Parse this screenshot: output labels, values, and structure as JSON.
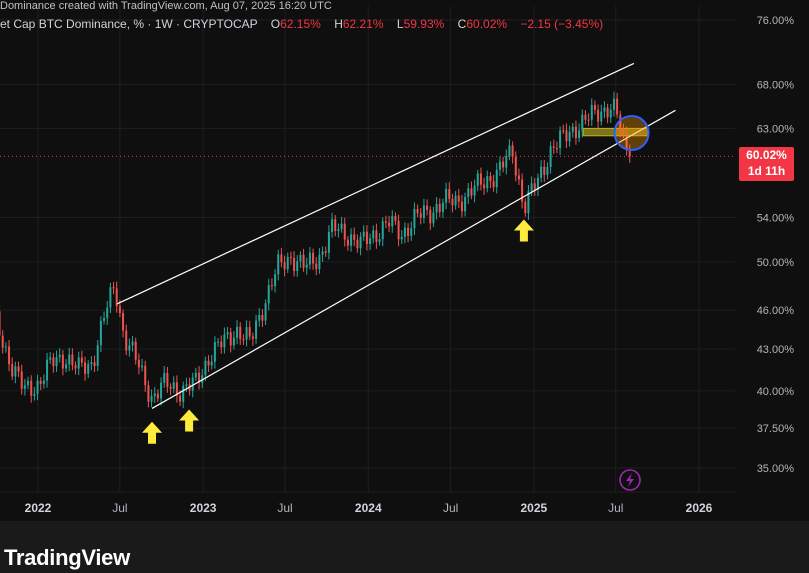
{
  "header": {
    "cropped_caption": "Dominance created with TradingView.com, Aug 07, 2025 16:20 UTC",
    "title": "et Cap BTC Dominance, % · 1W · CRYPTOCAP",
    "o_label": "O",
    "o_value": "62.15%",
    "h_label": "H",
    "h_value": "62.21%",
    "l_label": "L",
    "l_value": "59.93%",
    "c_label": "C",
    "c_value": "60.02%",
    "change": "−2.15 (−3.45%)"
  },
  "price_badge": {
    "price": "60.02%",
    "countdown": "1d 11h"
  },
  "footer": {
    "brand": "TradingView"
  },
  "colors": {
    "up": "#26a69a",
    "down": "#ef5350",
    "background": "#0f0f0f",
    "grid": "#1f1f1f",
    "axis_text": "#b2b5be",
    "arrow": "#ffeb3b",
    "badge": "#f23645",
    "circle": "#2962ff",
    "channel": "#ffffff"
  },
  "icons": [
    "lightning-icon",
    "arrow-up-icon"
  ],
  "chart_data": {
    "type": "candlestick",
    "title": "et Cap BTC Dominance, % · 1W · CRYPTOCAP",
    "scale": "log",
    "ylim": [
      33.5,
      80
    ],
    "yticks": [
      "76.00%",
      "68.00%",
      "63.00%",
      "60.02%",
      "54.00%",
      "50.00%",
      "46.00%",
      "43.00%",
      "40.00%",
      "37.50%",
      "35.00%"
    ],
    "ytick_values": [
      76,
      68,
      63,
      60.02,
      54,
      50,
      46,
      43,
      40,
      37.5,
      35
    ],
    "xticks": [
      "2022",
      "Jul",
      "2023",
      "Jul",
      "2024",
      "Jul",
      "2025",
      "Jul",
      "2026"
    ],
    "xtick_dates": [
      "2022-01-01",
      "2022-07-01",
      "2023-01-01",
      "2023-07-01",
      "2024-01-01",
      "2024-07-01",
      "2025-01-01",
      "2025-07-01",
      "2026-01-01"
    ],
    "last_price": 60.02,
    "close_path": [
      [
        "2021-10-01",
        45.0
      ],
      [
        "2021-11-01",
        42.0
      ],
      [
        "2021-12-01",
        40.0
      ],
      [
        "2022-01-01",
        40.5
      ],
      [
        "2022-02-01",
        42.0
      ],
      [
        "2022-03-01",
        42.5
      ],
      [
        "2022-04-01",
        41.5
      ],
      [
        "2022-05-01",
        42.0
      ],
      [
        "2022-06-01",
        46.0
      ],
      [
        "2022-06-20",
        48.0
      ],
      [
        "2022-07-10",
        44.0
      ],
      [
        "2022-08-15",
        41.5
      ],
      [
        "2022-09-10",
        39.5
      ],
      [
        "2022-10-10",
        40.5
      ],
      [
        "2022-11-15",
        40.0
      ],
      [
        "2022-12-15",
        40.5
      ],
      [
        "2023-01-15",
        42.5
      ],
      [
        "2023-02-15",
        43.5
      ],
      [
        "2023-03-15",
        44.5
      ],
      [
        "2023-04-15",
        43.5
      ],
      [
        "2023-05-15",
        46.5
      ],
      [
        "2023-06-15",
        49.5
      ],
      [
        "2023-07-15",
        50.5
      ],
      [
        "2023-08-15",
        49.5
      ],
      [
        "2023-09-15",
        50.5
      ],
      [
        "2023-10-15",
        53.0
      ],
      [
        "2023-11-15",
        52.5
      ],
      [
        "2023-12-15",
        51.5
      ],
      [
        "2024-01-15",
        52.5
      ],
      [
        "2024-02-15",
        53.5
      ],
      [
        "2024-03-15",
        52.5
      ],
      [
        "2024-04-15",
        54.0
      ],
      [
        "2024-05-15",
        54.5
      ],
      [
        "2024-06-15",
        55.5
      ],
      [
        "2024-07-15",
        55.5
      ],
      [
        "2024-08-15",
        56.5
      ],
      [
        "2024-09-15",
        57.5
      ],
      [
        "2024-10-15",
        58.5
      ],
      [
        "2024-11-15",
        60.5
      ],
      [
        "2024-12-10",
        55.0
      ],
      [
        "2025-01-10",
        57.5
      ],
      [
        "2025-02-10",
        61.0
      ],
      [
        "2025-03-10",
        62.0
      ],
      [
        "2025-04-10",
        63.5
      ],
      [
        "2025-05-15",
        64.5
      ],
      [
        "2025-06-15",
        65.5
      ],
      [
        "2025-07-01",
        65.0
      ],
      [
        "2025-07-20",
        61.0
      ],
      [
        "2025-08-07",
        60.02
      ]
    ],
    "channel_lines": [
      {
        "name": "upper",
        "from": [
          "2022-06-25",
          46.5
        ],
        "to": [
          "2025-08-10",
          70.5
        ]
      },
      {
        "name": "lower",
        "from": [
          "2022-09-10",
          38.8
        ],
        "to": [
          "2025-11-10",
          65.0
        ]
      }
    ],
    "horizontal_line": {
      "value": 60.02
    },
    "highlight_zone": {
      "from": "2025-04-20",
      "to": "2025-09-10",
      "low": 62.2,
      "high": 63.0
    },
    "circle_marker": {
      "date": "2025-08-05",
      "value": 62.5
    },
    "arrow_markers": [
      {
        "date": "2022-09-10",
        "value": 37.2
      },
      {
        "date": "2022-12-01",
        "value": 38.0
      },
      {
        "date": "2024-12-10",
        "value": 52.8
      }
    ]
  }
}
